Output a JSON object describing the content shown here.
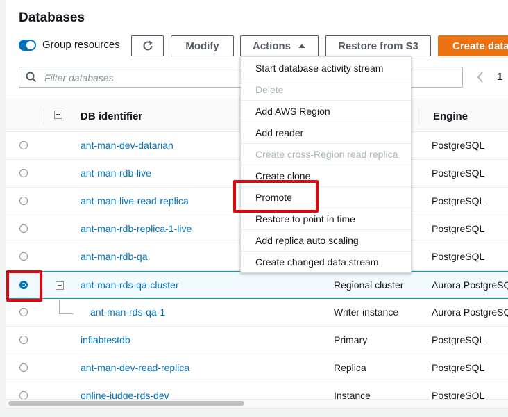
{
  "title": "Databases",
  "toolbar": {
    "group_resources_label": "Group resources",
    "group_resources_on": true,
    "modify_label": "Modify",
    "actions_label": "Actions",
    "restore_label": "Restore from S3",
    "create_label": "Create datab"
  },
  "search": {
    "placeholder": "Filter databases",
    "value": ""
  },
  "pagination": {
    "current_page": "1"
  },
  "table": {
    "headers": {
      "db_identifier": "DB identifier",
      "engine": "Engine"
    },
    "rows": [
      {
        "id": "ant-man-dev-datarian",
        "role": "",
        "engine": "PostgreSQL"
      },
      {
        "id": "ant-man-rdb-live",
        "role": "",
        "engine": "PostgreSQL"
      },
      {
        "id": "ant-man-live-read-replica",
        "role": "",
        "engine": "PostgreSQL"
      },
      {
        "id": "ant-man-rdb-replica-1-live",
        "role": "",
        "engine": "PostgreSQL"
      },
      {
        "id": "ant-man-rdb-qa",
        "role": "",
        "engine": "PostgreSQL"
      },
      {
        "id": "ant-man-rds-qa-cluster",
        "role": "Regional cluster",
        "engine": "Aurora PostgreSQL"
      },
      {
        "id": "ant-man-rds-qa-1",
        "role": "Writer instance",
        "engine": "Aurora PostgreSQL"
      },
      {
        "id": "inflabtestdb",
        "role": "Primary",
        "engine": "PostgreSQL"
      },
      {
        "id": "ant-man-dev-read-replica",
        "role": "Replica",
        "engine": "PostgreSQL"
      },
      {
        "id": "online-judge-rds-dev",
        "role": "Instance",
        "engine": "PostgreSQL"
      }
    ],
    "selected_row": "ant-man-rds-qa-cluster"
  },
  "actions_menu": {
    "items": [
      {
        "label": "Start database activity stream",
        "disabled": false
      },
      {
        "label": "Delete",
        "disabled": true
      },
      {
        "label": "Add AWS Region",
        "disabled": false
      },
      {
        "label": "Add reader",
        "disabled": false
      },
      {
        "label": "Create cross-Region read replica",
        "disabled": true
      },
      {
        "label": "Create clone",
        "disabled": false
      },
      {
        "label": "Promote",
        "disabled": false
      },
      {
        "label": "Restore to point in time",
        "disabled": false
      },
      {
        "label": "Add replica auto scaling",
        "disabled": false
      },
      {
        "label": "Create changed data stream",
        "disabled": false
      }
    ],
    "highlighted_item": "Promote"
  },
  "icons": {
    "refresh": "refresh-icon",
    "caret_up": "caret-up-icon",
    "search": "search-icon",
    "pager_prev": "chevron-left-icon"
  },
  "colors": {
    "link": "#0073bb",
    "primary_button": "#ec7211",
    "highlight": "#e0060d",
    "disabled_text": "#aab7b8"
  }
}
